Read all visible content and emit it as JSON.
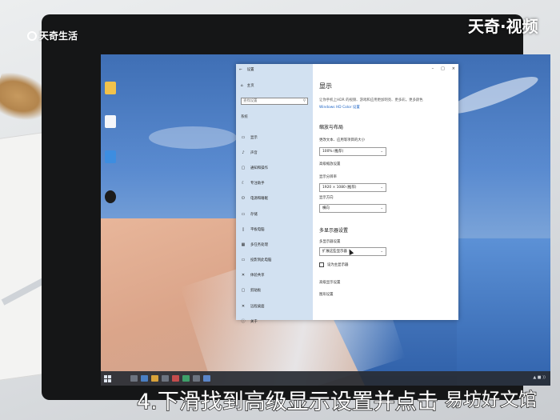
{
  "overlay": {
    "logo_left": "天奇生活",
    "logo_right": "天奇·视频",
    "caption": "4.下滑找到高级显示设置并点击",
    "caption_right": "易坊好文馆"
  },
  "window": {
    "back_icon": "←",
    "title": "设置",
    "minimize": "–",
    "maximize": "□",
    "close": "×"
  },
  "sidebar": {
    "home_label": "主页",
    "home_icon": "⌂",
    "search_placeholder": "查找设置",
    "search_icon": "⚲",
    "group_label": "系统",
    "items": [
      {
        "label": "显示",
        "icon": "▭"
      },
      {
        "label": "声音",
        "icon": "♪"
      },
      {
        "label": "通知和操作",
        "icon": "▢"
      },
      {
        "label": "专注助手",
        "icon": "☾"
      },
      {
        "label": "电源和睡眠",
        "icon": "⏻"
      },
      {
        "label": "存储",
        "icon": "▭"
      },
      {
        "label": "平板电脑",
        "icon": "▯"
      },
      {
        "label": "多任务处理",
        "icon": "▦"
      },
      {
        "label": "投影到此电脑",
        "icon": "▭"
      },
      {
        "label": "体验共享",
        "icon": "✕"
      },
      {
        "label": "剪贴板",
        "icon": "▢"
      },
      {
        "label": "远程桌面",
        "icon": "✕"
      },
      {
        "label": "关于",
        "icon": "ⓘ"
      }
    ]
  },
  "main": {
    "title": "显示",
    "desc": "让你手机上HDR 的视频、游戏和应用更加明亮、更多彩。更多颜色",
    "desc_link": "Windows HD Color 设置",
    "section_scale": "缩放与布局",
    "scale_label": "更改文本、应用等项目的大小",
    "scale_value": "100% (推荐)",
    "scale_link": "高级缩放设置",
    "resolution_label": "显示分辨率",
    "resolution_value": "1920 × 1080 (推荐)",
    "orientation_label": "显示方向",
    "orientation_value": "横向",
    "section_multi": "多显示器设置",
    "multi_label": "多显示器设置",
    "multi_value": "扩展这些显示器",
    "main_display_check": "设为主显示器",
    "advanced_link": "高级显示设置",
    "graphics_link": "图形设置",
    "chevron": "⌄"
  },
  "taskbar": {
    "tray_text": "▲  ■  ))"
  }
}
